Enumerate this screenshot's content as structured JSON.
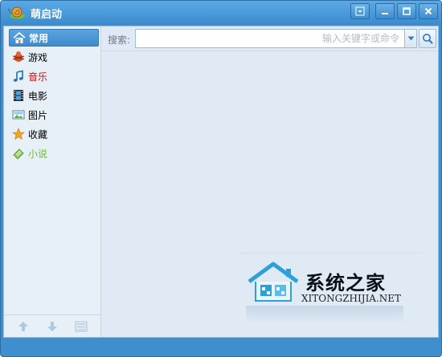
{
  "window": {
    "title": "萌启动"
  },
  "sidebar": {
    "items": [
      {
        "label": "常用",
        "icon": "home-icon",
        "active": true
      },
      {
        "label": "游戏",
        "icon": "game-icon"
      },
      {
        "label": "音乐",
        "icon": "music-icon",
        "color": "#c0161b"
      },
      {
        "label": "电影",
        "icon": "film-icon"
      },
      {
        "label": "图片",
        "icon": "picture-icon"
      },
      {
        "label": "收藏",
        "icon": "star-icon"
      },
      {
        "label": "小说",
        "icon": "book-icon",
        "color": "#6abf2a"
      }
    ],
    "bottom_buttons": [
      "move-up-icon",
      "move-down-icon",
      "list-view-icon"
    ]
  },
  "search": {
    "label": "搜索:",
    "placeholder": "输入关键字或命令",
    "value": ""
  },
  "watermark": {
    "title": "系统之家",
    "subtitle": "XITONGZHIJIA.NET"
  },
  "colors": {
    "titlebar": "#4d9cdb",
    "active_item": "#4a97d6",
    "content_bg": "#dfeaf4"
  }
}
